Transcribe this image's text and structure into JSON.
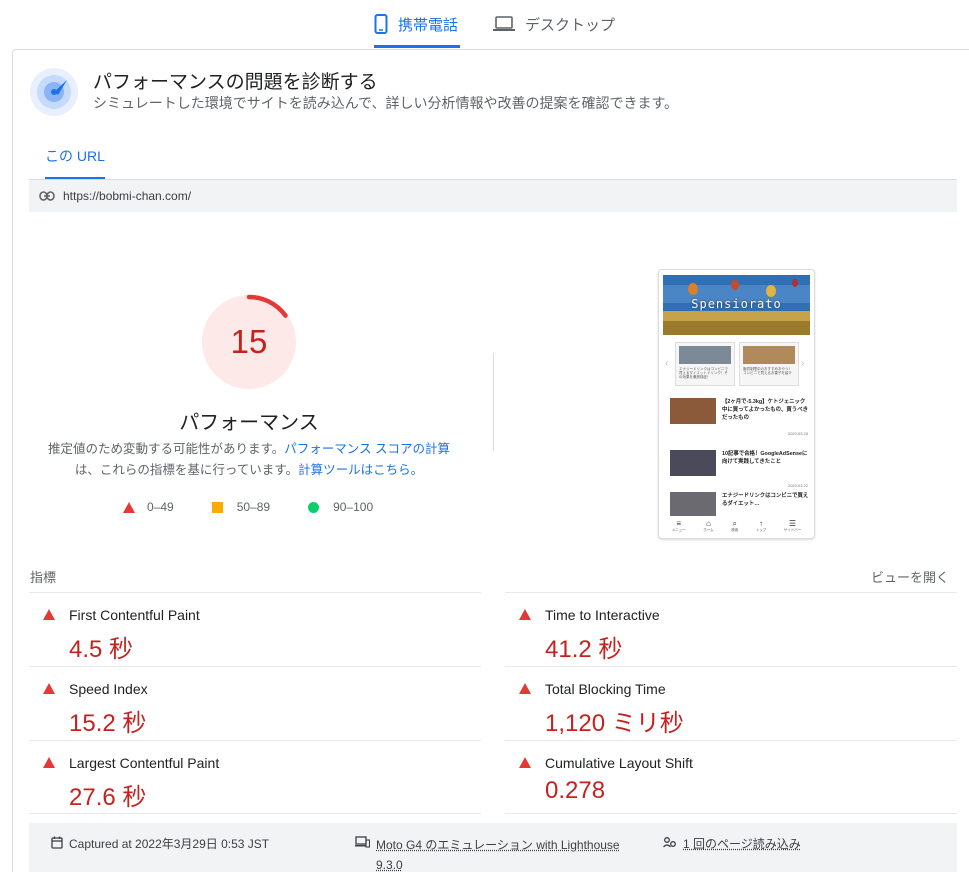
{
  "device_tabs": {
    "mobile": "携帯電話",
    "desktop": "デスクトップ"
  },
  "header": {
    "title": "パフォーマンスの問題を診断する",
    "subtitle": "シミュレートした環境でサイトを読み込んで、詳しい分析情報や改善の提案を確認できます。"
  },
  "url_tab": "この URL",
  "url": "https://bobmi-chan.com/",
  "score": {
    "value": "15",
    "value_fraction": 0.15,
    "label": "パフォーマンス",
    "note_part1": "推定値のため変動する可能性があります。",
    "note_link1": "パフォーマンス スコアの計算",
    "note_part2": "は、これらの指標を基に行っています。",
    "note_link2": "計算ツールはこちら。",
    "color": "#c5221f"
  },
  "legend": {
    "poor": "0–49",
    "average": "50–89",
    "good": "90–100"
  },
  "screenshot": {
    "site_title": "Spensiorato",
    "slide1": "エナジードリンクはコンビニで買えるダイエットドリンク！その効果を徹底検証！",
    "slide2": "脂質制限中のおすすめおやつ！コンビニで買えるお菓子を紹介",
    "articles": [
      {
        "title": "【2ヶ月で-5.3kg】ケトジェニック中に買ってよかったもの、買うべきだったもの",
        "date": "2022.03.28"
      },
      {
        "title": "10記事で合格！GoogleAdSenseに向けて実践してきたこと",
        "date": "2022.03.22"
      },
      {
        "title": "エナジードリンクはコンビニで買えるダイエット…",
        "date": ""
      }
    ],
    "nav": [
      "メニュー",
      "ホーム",
      "検索",
      "トップ",
      "サイドバー"
    ]
  },
  "metrics": {
    "title": "指標",
    "open_view": "ビューを開く",
    "items": [
      {
        "name": "First Contentful Paint",
        "value": "4.5 秒"
      },
      {
        "name": "Time to Interactive",
        "value": "41.2 秒"
      },
      {
        "name": "Speed Index",
        "value": "15.2 秒"
      },
      {
        "name": "Total Blocking Time",
        "value": "1,120 ミリ秒"
      },
      {
        "name": "Largest Contentful Paint",
        "value": "27.6 秒"
      },
      {
        "name": "Cumulative Layout Shift",
        "value": "0.278"
      }
    ]
  },
  "footer": {
    "captured": "Captured at 2022年3月29日 0:53 JST",
    "device_line1": "Moto G4 のエミュレーション with Lighthouse",
    "device_line2": "9.3.0",
    "loads": "1 回のページ読み込み"
  },
  "colors": {
    "accent": "#1a73e8",
    "fail": "#c5221f",
    "fail_icon": "#e53935",
    "average": "#f9ab00",
    "pass": "#0cce6b"
  },
  "icons": {
    "mobile": "phone-icon",
    "desktop": "laptop-icon",
    "header": "gauge-icon",
    "url": "link-icon",
    "calendar": "calendar-icon",
    "device": "devices-icon",
    "loads": "people-icon"
  }
}
